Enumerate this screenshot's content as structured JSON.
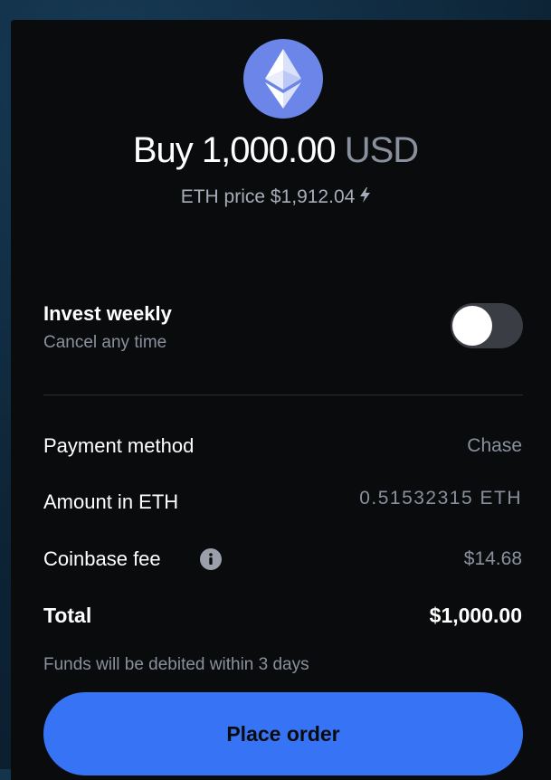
{
  "header": {
    "asset_icon": "ethereum-icon",
    "action": "Buy",
    "amount": "1,000.00",
    "currency": "USD",
    "price_label": "ETH price $1,912.04",
    "price_indicator_icon": "lightning-bolt-icon"
  },
  "recurring": {
    "title": "Invest weekly",
    "subtitle": "Cancel any time",
    "enabled": false
  },
  "details": [
    {
      "label": "Payment method",
      "value": "Chase"
    },
    {
      "label": "Amount in ETH",
      "value": "0.51532315 ETH"
    },
    {
      "label": "Coinbase fee",
      "value": "$14.68",
      "icon": "info-icon"
    }
  ],
  "total": {
    "label": "Total",
    "value": "$1,000.00"
  },
  "note": "Funds will be debited within 3 days",
  "cta": {
    "label": "Place order"
  },
  "colors": {
    "background": "#0a0b0d",
    "accent": "#3773f5",
    "eth_badge": "#6b86e8",
    "muted_text": "#8a919e"
  }
}
